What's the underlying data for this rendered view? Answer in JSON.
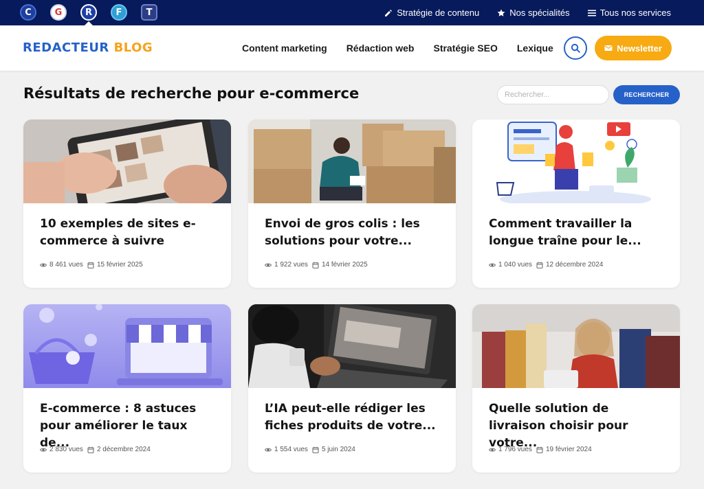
{
  "topbar": {
    "sites": [
      {
        "letter": "C",
        "icon": "c-site-icon"
      },
      {
        "letter": "G",
        "icon": "g-site-icon"
      },
      {
        "letter": "R",
        "icon": "r-site-icon"
      },
      {
        "letter": "F",
        "icon": "f-site-icon"
      },
      {
        "letter": "T",
        "icon": "t-site-icon"
      }
    ],
    "links": [
      {
        "label": "Stratégie de contenu",
        "icon": "pencil-icon"
      },
      {
        "label": "Nos spécialités",
        "icon": "star-icon"
      },
      {
        "label": "Tous nos services",
        "icon": "list-icon"
      }
    ]
  },
  "header": {
    "logo_part1": "REDACTEUR",
    "logo_part2": "BLOG",
    "nav": [
      "Content marketing",
      "Rédaction web",
      "Stratégie SEO",
      "Lexique"
    ],
    "newsletter_label": "Newsletter"
  },
  "results": {
    "title": "Résultats de recherche pour e-commerce",
    "search_placeholder": "Rechercher...",
    "search_button": "RECHERCHER"
  },
  "cards": [
    {
      "title": "10 exemples de sites e-commerce à suivre",
      "views": "8 461 vues",
      "date": "15 février 2025"
    },
    {
      "title": "Envoi de gros colis : les solutions pour votre...",
      "views": "1 922 vues",
      "date": "14 février 2025"
    },
    {
      "title": "Comment travailler la longue traîne pour le...",
      "views": "1 040 vues",
      "date": "12 décembre 2024"
    },
    {
      "title": "E-commerce : 8 astuces pour améliorer le taux de...",
      "views": "2 830 vues",
      "date": "2 décembre 2024"
    },
    {
      "title": "L’IA peut-elle rédiger les fiches produits de votre...",
      "views": "1 554 vues",
      "date": "5 juin 2024"
    },
    {
      "title": "Quelle solution de livraison choisir pour votre...",
      "views": "1 796 vues",
      "date": "19 février 2024"
    }
  ],
  "colors": {
    "topbar": "#061a5c",
    "brand_blue": "#2561c9",
    "accent_orange": "#f7aa12"
  }
}
